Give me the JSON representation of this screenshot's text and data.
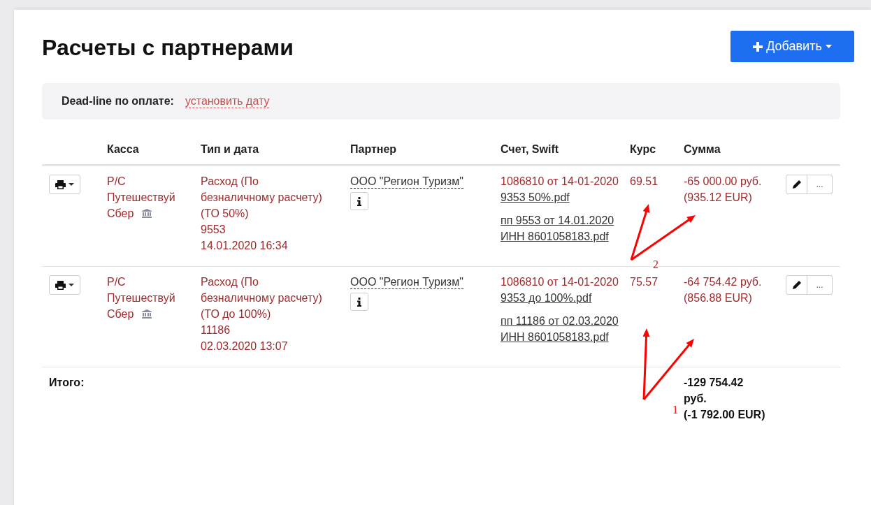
{
  "title": "Расчеты с партнерами",
  "add_button": {
    "label": "Добавить"
  },
  "deadline": {
    "label": "Dead-line по оплате:",
    "link": "установить дату"
  },
  "columns": [
    "Касса",
    "Тип и дата",
    "Партнер",
    "Счет, Swift",
    "Курс",
    "Сумма"
  ],
  "rows": [
    {
      "cashbox": [
        "Р/С",
        "Путешествуй",
        "Сбер"
      ],
      "type": [
        "Расход (По безналичному расчету) (ТО 50%)",
        "9553",
        "14.01.2020 16:34"
      ],
      "partner": "ООО \"Регион Туризм\"",
      "invoice": "1086810 от 14-01-2020",
      "files": [
        "9353 50%.pdf",
        "пп 9553 от 14.01.2020 ИНН 8601058183.pdf"
      ],
      "rate": "69.51",
      "sum": "-65 000.00 руб.",
      "sum_eur": "(935.12 EUR)",
      "more_label": "..."
    },
    {
      "cashbox": [
        "Р/С",
        "Путешествуй",
        "Сбер"
      ],
      "type": [
        "Расход (По безналичному расчету) (ТО до 100%)",
        "11186",
        "02.03.2020 13:07"
      ],
      "partner": "ООО \"Регион Туризм\"",
      "invoice": "1086810 от 14-01-2020",
      "files": [
        "9353 до 100%.pdf",
        "пп 11186 от 02.03.2020 ИНН 8601058183.pdf"
      ],
      "rate": "75.57",
      "sum": "-64 754.42 руб.",
      "sum_eur": "(856.88 EUR)",
      "more_label": "..."
    }
  ],
  "total": {
    "label": "Итого:",
    "amount": "-129 754.42 руб.",
    "amount_eur": "(-1 792.00 EUR)"
  },
  "annotations": [
    {
      "label": "2"
    },
    {
      "label": "1"
    }
  ]
}
